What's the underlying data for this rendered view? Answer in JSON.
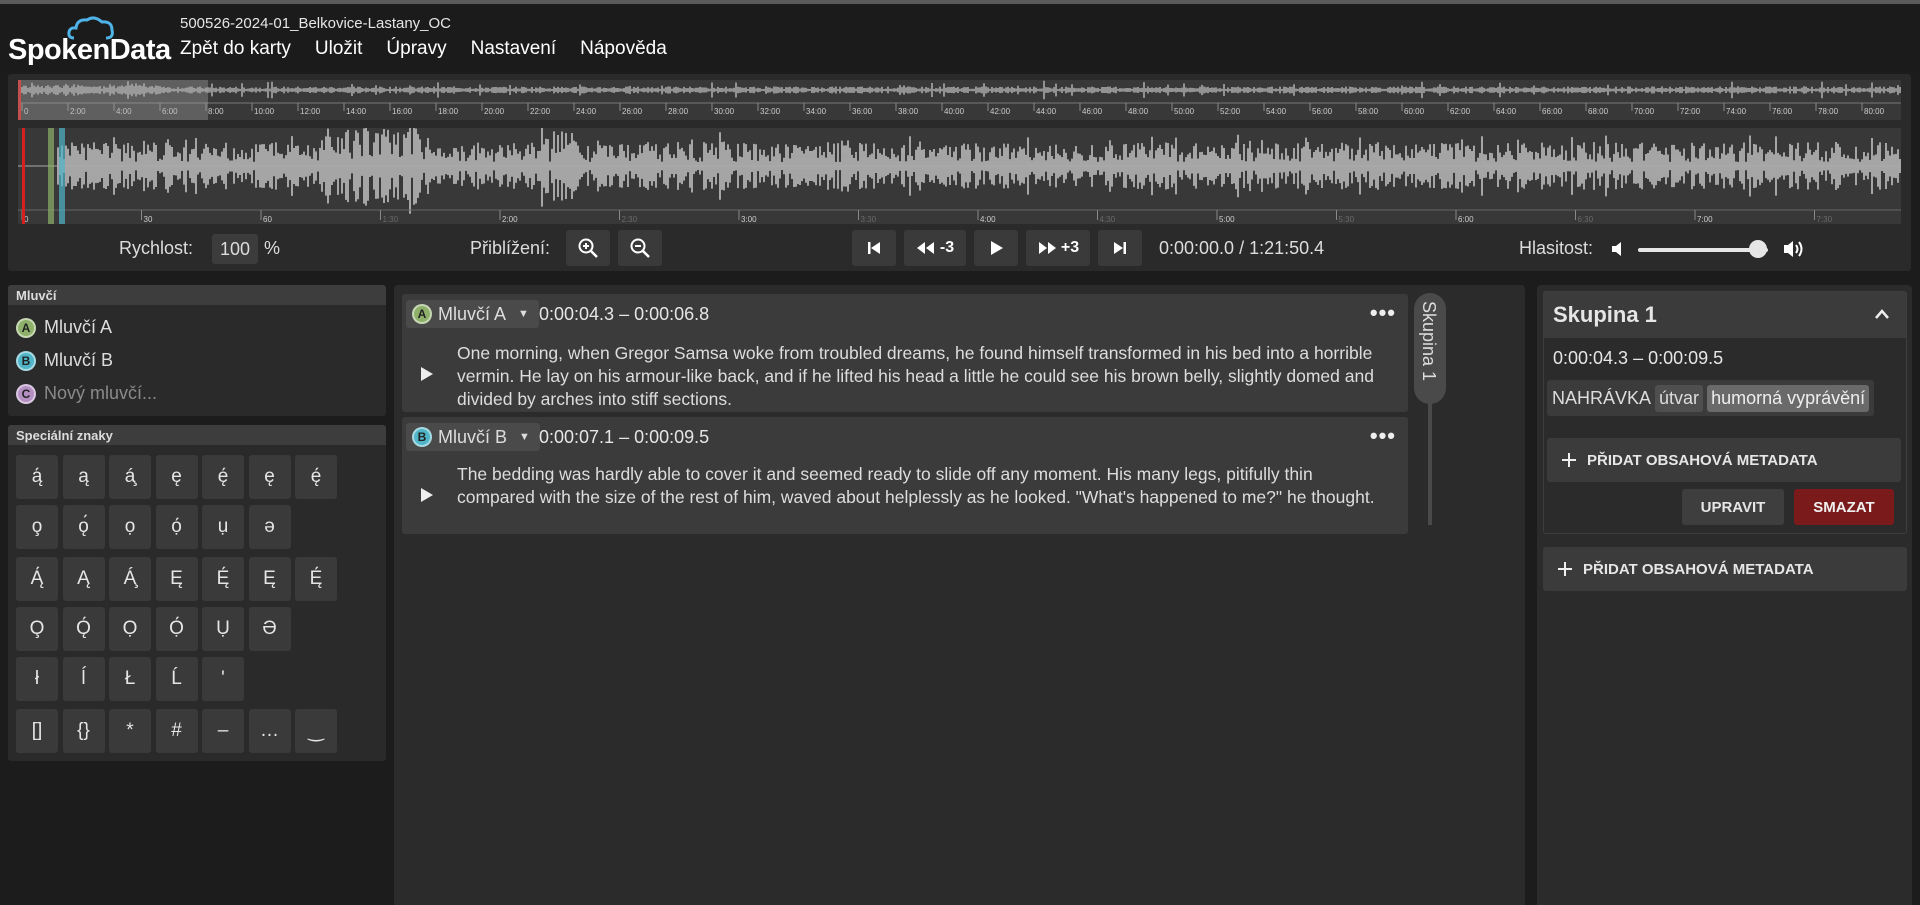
{
  "app": {
    "logo_text": "SpokenData",
    "file_name": "500526-2024-01_Belkovice-Lastany_OC"
  },
  "menu": [
    "Zpět do karty",
    "Uložit",
    "Úpravy",
    "Nastavení",
    "Nápověda"
  ],
  "timeline": {
    "overview_ticks": [
      "0",
      "2:00",
      "4:00",
      "6:00",
      "8:00",
      "10:00",
      "12:00",
      "14:00",
      "16:00",
      "18:00",
      "20:00",
      "22:00",
      "24:00",
      "26:00",
      "28:00",
      "30:00",
      "32:00",
      "34:00",
      "36:00",
      "38:00",
      "40:00",
      "42:00",
      "44:00",
      "46:00",
      "48:00",
      "50:00",
      "52:00",
      "54:00",
      "56:00",
      "58:00",
      "60:00",
      "62:00",
      "64:00",
      "66:00",
      "68:00",
      "70:00",
      "72:00",
      "74:00",
      "76:00",
      "78:00",
      "80:00"
    ],
    "detail_ticks": [
      "0",
      "30",
      "60",
      "1:30",
      "2:00",
      "2:30",
      "3:00",
      "3:30",
      "4:00",
      "4:30",
      "5:00",
      "5:30",
      "6:00",
      "6:30",
      "7:00",
      "7:30"
    ]
  },
  "controls": {
    "speed_label": "Rychlost:",
    "speed_value": "100",
    "speed_unit": "%",
    "zoom_label": "Přiblížení:",
    "back_label": "-3",
    "forward_label": "+3",
    "time": "0:00:00.0 / 1:21:50.4",
    "volume_label": "Hlasitost:",
    "volume_level": 0.92
  },
  "speakers": {
    "title": "Mluvčí",
    "items": [
      {
        "badge": "A",
        "name": "Mluvčí A",
        "color": "#8fb06a"
      },
      {
        "badge": "B",
        "name": "Mluvčí B",
        "color": "#4fb5c7"
      },
      {
        "badge": "C",
        "name": "Nový mluvčí...",
        "color": "#b48fc2"
      }
    ]
  },
  "special_chars": {
    "title": "Speciální znaky",
    "rows": [
      [
        "ą́",
        "ą",
        "á̧",
        "ę",
        "ę́",
        "ę",
        "ę́"
      ],
      [
        "o̧",
        "ǫ́",
        "ọ",
        "ọ́",
        "ụ",
        "ə"
      ],
      [
        "Ą́",
        "Ą",
        "Á̧",
        "Ę",
        "Ę́",
        "Ę",
        "Ę́"
      ],
      [
        "O̧",
        "Ǫ́",
        "Ọ",
        "Ọ́",
        "Ụ",
        "Ə"
      ],
      [
        "ł",
        "ĺ",
        "Ł",
        "Ĺ",
        "'"
      ],
      [
        "[]",
        "{}",
        "*",
        "#",
        "–",
        "…",
        "‿"
      ]
    ]
  },
  "segments": [
    {
      "speaker_badge": "A",
      "speaker": "Mluvčí A",
      "time": "0:00:04.3 – 0:00:06.8",
      "text": "One morning, when Gregor Samsa woke from troubled dreams, he found himself transformed in his bed into a horrible vermin. He lay on his armour-like back, and if he lifted his head a little he could see his brown belly, slightly domed and divided by arches into stiff sections."
    },
    {
      "speaker_badge": "B",
      "speaker": "Mluvčí B",
      "time": "0:00:07.1 – 0:00:09.5",
      "text": "The bedding was hardly able to cover it and seemed ready to slide off any moment. His many legs, pitifully thin compared with the size of the rest of him, waved about helplessly as he looked. \"What's happened to me?\" he thought."
    }
  ],
  "group_tab": "Skupina 1",
  "group": {
    "title": "Skupina 1",
    "time": "0:00:04.3 – 0:00:09.5",
    "meta_key": "NAHRÁVKA",
    "meta_attr": "útvar",
    "meta_value": "humorná vyprávění",
    "add_meta": "PŘIDAT OBSAHOVÁ METADATA",
    "edit": "UPRAVIT",
    "delete": "SMAZAT"
  },
  "add_meta_bottom": "PŘIDAT OBSAHOVÁ METADATA"
}
